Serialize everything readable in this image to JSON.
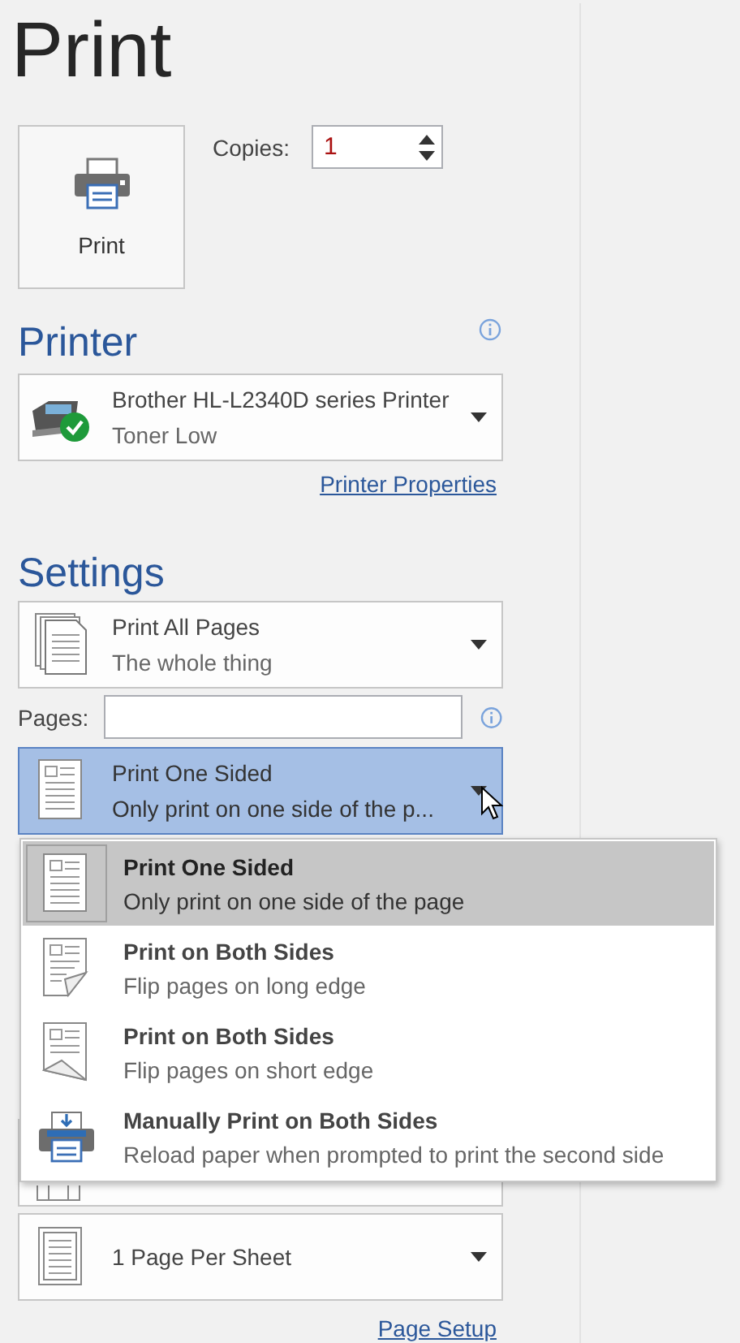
{
  "title": "Print",
  "print_button": {
    "label": "Print"
  },
  "copies": {
    "label": "Copies:",
    "value": "1"
  },
  "printer": {
    "heading": "Printer",
    "name": "Brother HL-L2340D series Printer",
    "status": "Toner Low",
    "link": "Printer Properties"
  },
  "settings": {
    "heading": "Settings",
    "range": {
      "title": "Print All Pages",
      "subtitle": "The whole thing"
    },
    "pages": {
      "label": "Pages:"
    },
    "sides": {
      "title": "Print One Sided",
      "subtitle": "Only print on one side of the p...",
      "expanded": true,
      "options": [
        {
          "kind": "one_sided",
          "title": "Print One Sided",
          "description": "Only print on one side of the page",
          "selected": true
        },
        {
          "kind": "long_edge",
          "title": "Print on Both Sides",
          "description": "Flip pages on long edge",
          "selected": false
        },
        {
          "kind": "short_edge",
          "title": "Print on Both Sides",
          "description": "Flip pages on short edge",
          "selected": false
        },
        {
          "kind": "manual",
          "title": "Manually Print on Both Sides",
          "description": "Reload paper when prompted to print the second side",
          "selected": false
        }
      ]
    },
    "per_sheet": {
      "title": "1 Page Per Sheet"
    },
    "link": "Page Setup"
  }
}
